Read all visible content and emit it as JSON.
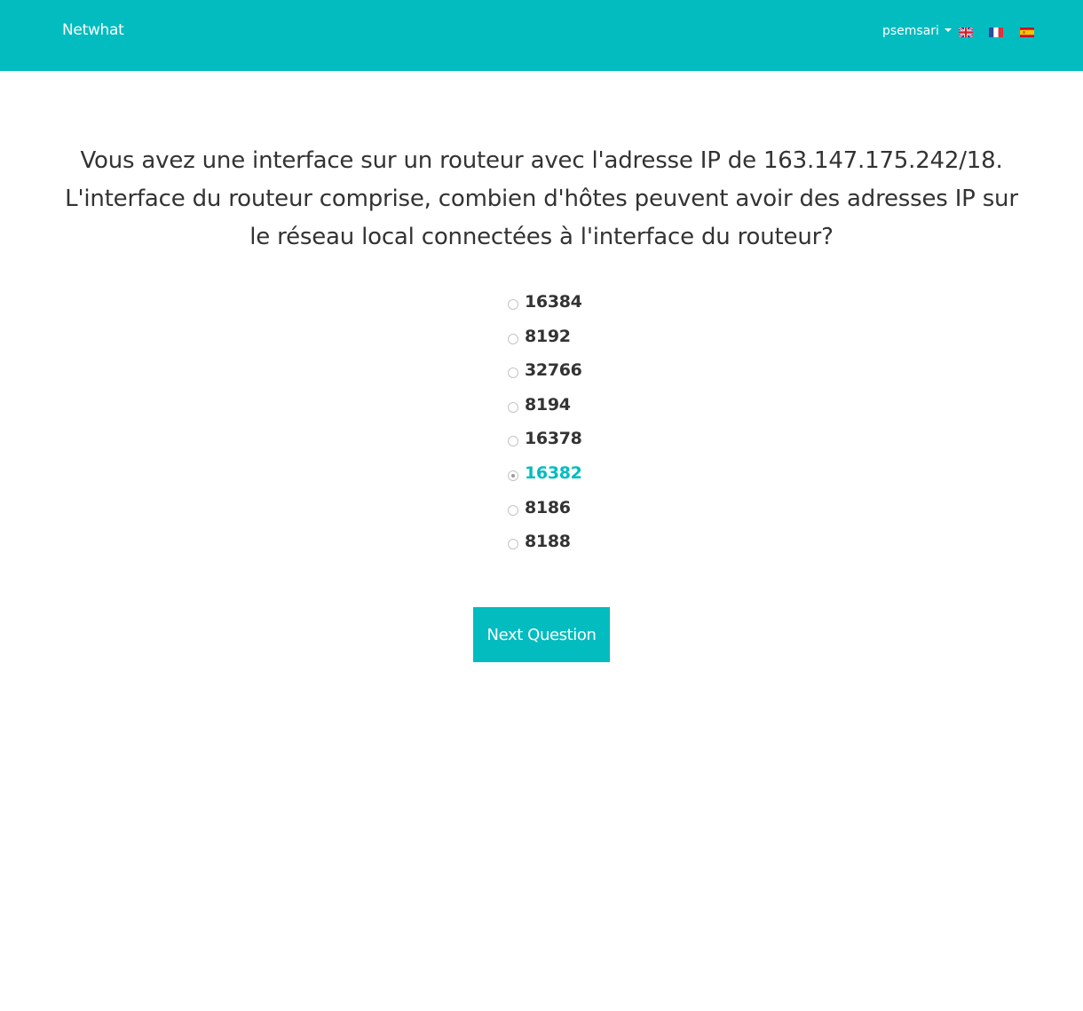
{
  "navbar": {
    "brand": "Netwhat",
    "user": "psemsari",
    "languages": [
      {
        "code": "en",
        "icon": "flag-uk-icon"
      },
      {
        "code": "fr",
        "icon": "flag-france-icon"
      },
      {
        "code": "es",
        "icon": "flag-spain-icon"
      }
    ],
    "colors": {
      "primary": "#02bcbf"
    }
  },
  "question": {
    "text": "Vous avez une interface sur un routeur avec l'adresse IP de 163.147.175.242/18. L'interface du routeur comprise, combien d'hôtes peuvent avoir des adresses IP sur le réseau local connectées à l'interface du routeur?"
  },
  "answers": [
    {
      "label": "16384",
      "selected": false
    },
    {
      "label": "8192",
      "selected": false
    },
    {
      "label": "32766",
      "selected": false
    },
    {
      "label": "8194",
      "selected": false
    },
    {
      "label": "16378",
      "selected": false
    },
    {
      "label": "16382",
      "selected": true
    },
    {
      "label": "8186",
      "selected": false
    },
    {
      "label": "8188",
      "selected": false
    }
  ],
  "next_button": {
    "label": "Next Question"
  }
}
